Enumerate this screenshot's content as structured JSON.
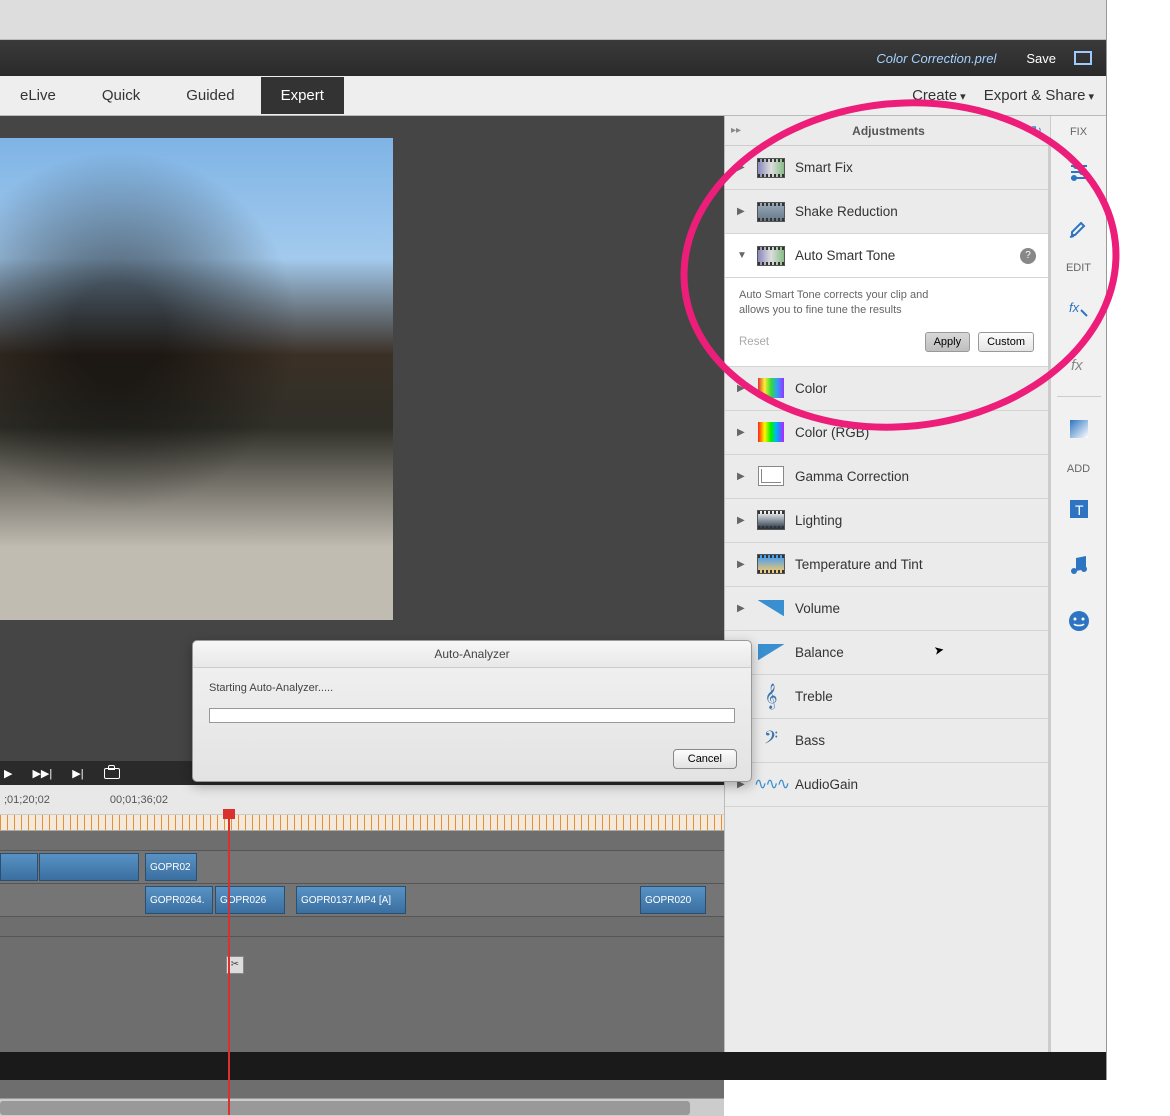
{
  "project_name": "Color Correction.prel",
  "save_label": "Save",
  "modes": {
    "elive": "eLive",
    "quick": "Quick",
    "guided": "Guided",
    "expert": "Expert"
  },
  "top_actions": {
    "create": "Create",
    "export": "Export & Share"
  },
  "panel": {
    "title": "Adjustments",
    "items": {
      "smart_fix": "Smart Fix",
      "shake": "Shake Reduction",
      "auto_tone": "Auto Smart Tone",
      "color": "Color",
      "color_rgb": "Color (RGB)",
      "gamma": "Gamma Correction",
      "lighting": "Lighting",
      "temp": "Temperature and Tint",
      "volume": "Volume",
      "balance": "Balance",
      "treble": "Treble",
      "bass": "Bass",
      "audiogain": "AudioGain"
    },
    "auto_tone_desc": "Auto Smart Tone corrects your clip and allows you to fine tune the results",
    "reset": "Reset",
    "apply": "Apply",
    "custom": "Custom"
  },
  "side": {
    "fix": "FIX",
    "edit": "EDIT",
    "add": "ADD"
  },
  "timecodes": {
    "a": ";01;20;02",
    "b": "00;01;36;02"
  },
  "clips": {
    "c1": "GOPR02",
    "c2": "GOPR0264.",
    "c3": "GOPR026",
    "c4": "GOPR0137.MP4 [A]",
    "c5": "GOPR020"
  },
  "transport": {
    "play": "▶",
    "next": "▶▶|",
    "step": "▶|"
  },
  "dialog": {
    "title": "Auto-Analyzer",
    "message": "Starting Auto-Analyzer.....",
    "cancel": "Cancel"
  }
}
